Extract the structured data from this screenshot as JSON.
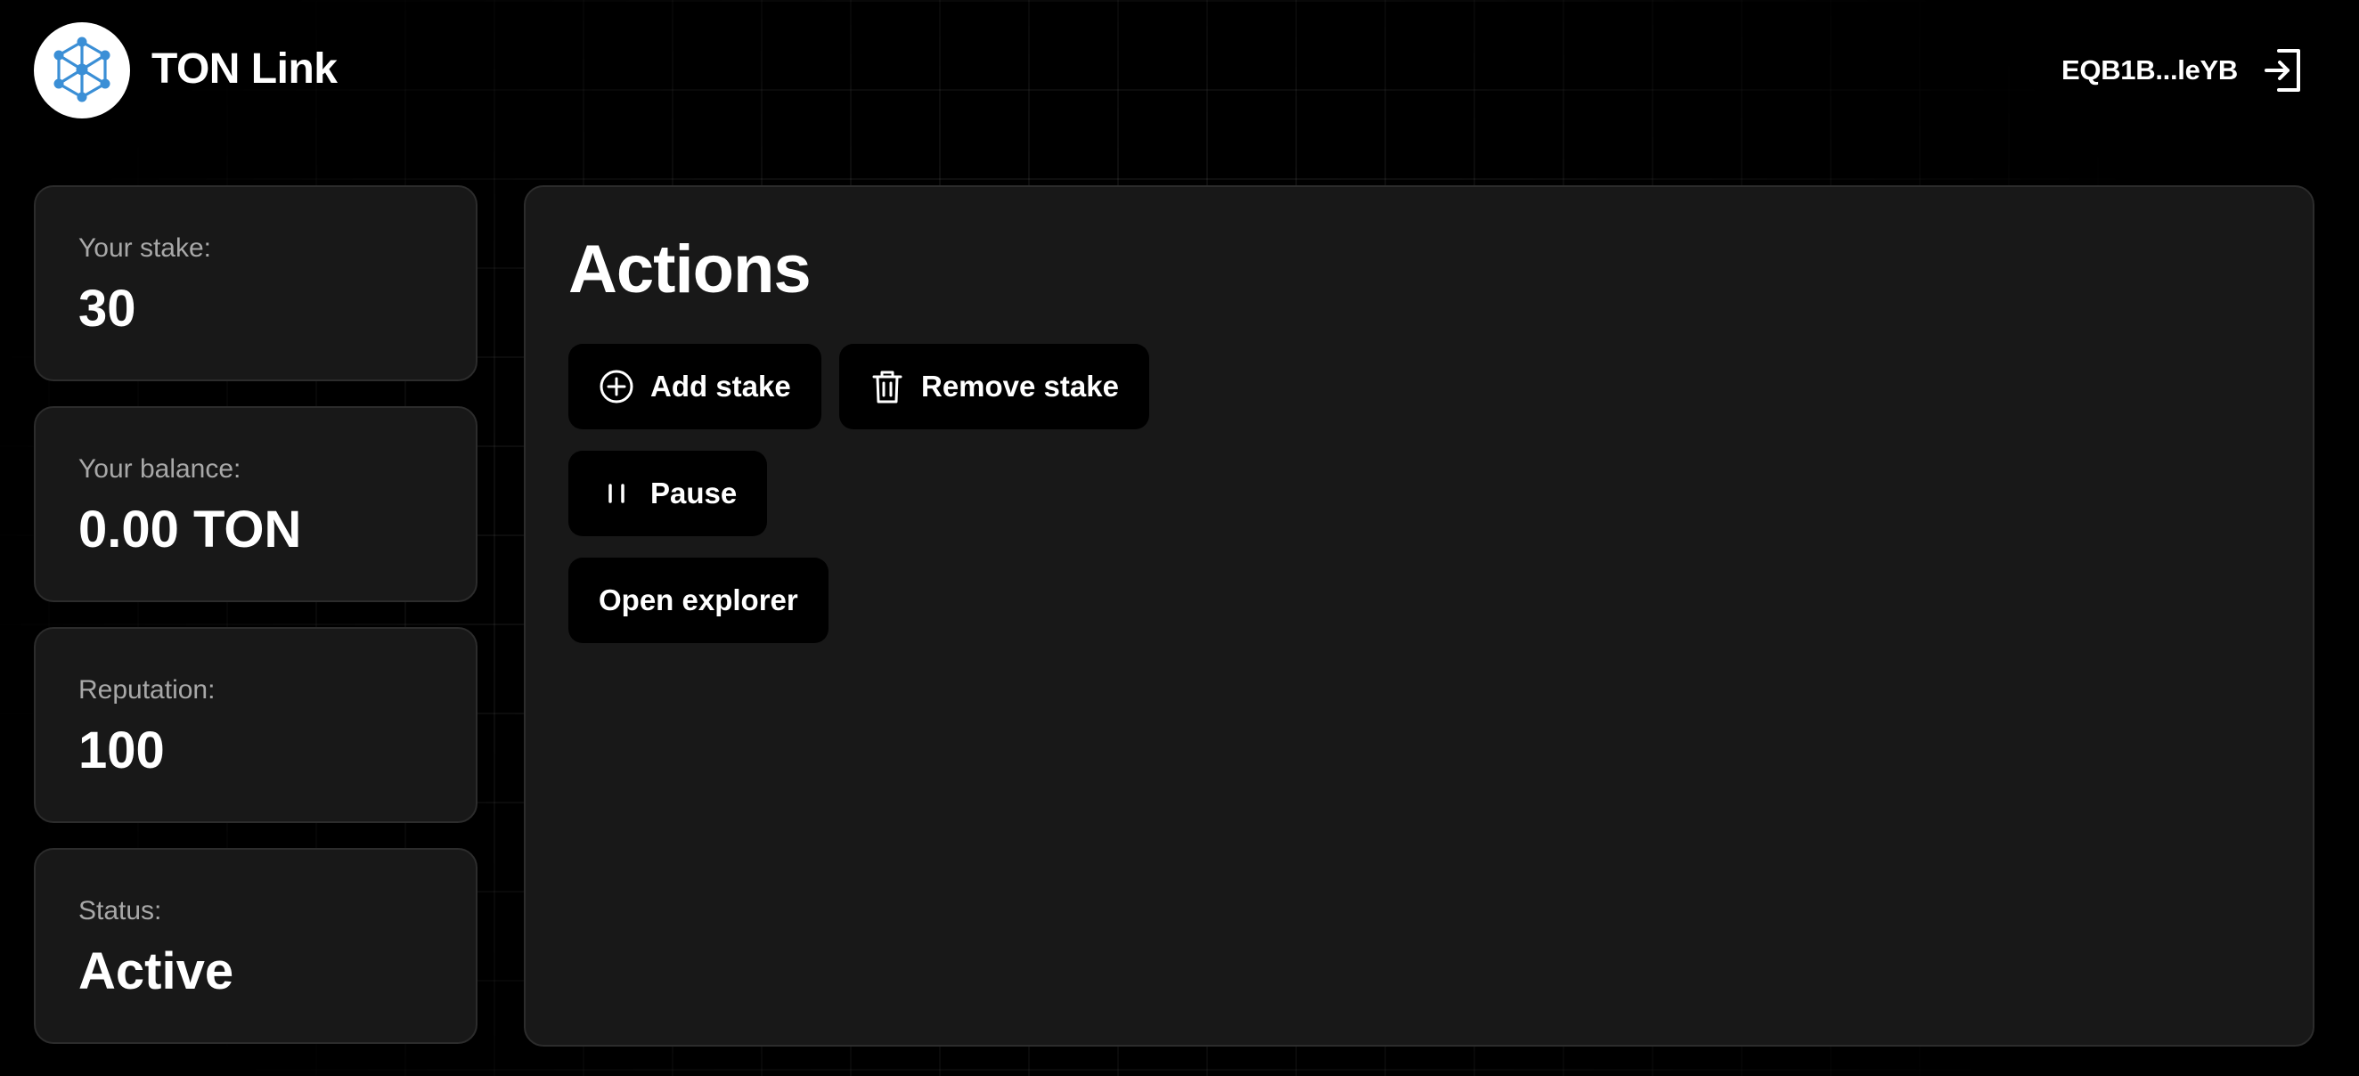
{
  "header": {
    "logo_icon": "hexagon-network-icon",
    "title": "TON Link",
    "wallet_address": "EQB1B...leYB",
    "logout_icon": "logout-icon"
  },
  "stats": [
    {
      "label": "Your stake:",
      "value": "30"
    },
    {
      "label": "Your balance:",
      "value": "0.00 TON"
    },
    {
      "label": "Reputation:",
      "value": "100"
    },
    {
      "label": "Status:",
      "value": "Active"
    }
  ],
  "actions": {
    "title": "Actions",
    "buttons": [
      {
        "label": "Add stake",
        "icon": "plus-circle-icon"
      },
      {
        "label": "Remove stake",
        "icon": "trash-icon"
      },
      {
        "label": "Pause",
        "icon": "pause-icon"
      },
      {
        "label": "Open explorer"
      }
    ]
  },
  "colors": {
    "background": "#000000",
    "card": "#181818",
    "card_border": "#2c2c2c",
    "logo_accent": "#3b8fd6",
    "label_muted": "#a8a8a8",
    "text": "#ffffff"
  }
}
